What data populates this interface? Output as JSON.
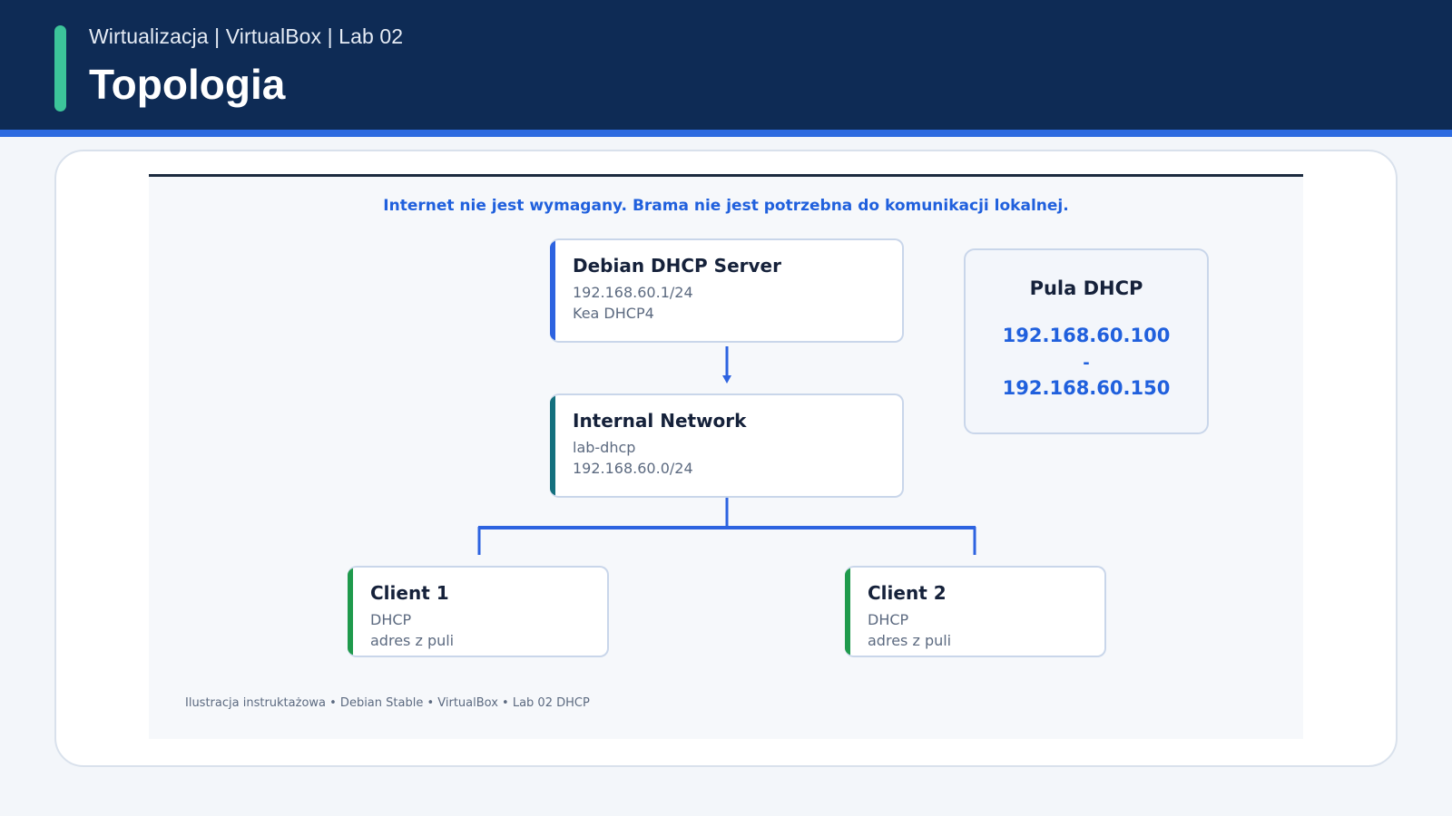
{
  "header": {
    "subtitle": "Wirtualizacja | VirtualBox | Lab 02",
    "title": "Topologia"
  },
  "diagram": {
    "note": "Internet nie jest wymagany. Brama nie jest potrzebna do komunikacji lokalnej.",
    "nodes": [
      {
        "title": "Debian DHCP Server",
        "lines": [
          "192.168.60.1/24",
          "Kea DHCP4"
        ],
        "accent": "#2d63e0"
      },
      {
        "title": "Internal Network",
        "lines": [
          "lab-dhcp",
          "192.168.60.0/24"
        ],
        "accent": "#14707e"
      },
      {
        "title": "Client 1",
        "lines": [
          "DHCP",
          "adres z puli"
        ],
        "accent": "#1f9a4c"
      },
      {
        "title": "Client 2",
        "lines": [
          "DHCP",
          "adres z puli"
        ],
        "accent": "#1f9a4c"
      }
    ],
    "pool": {
      "title": "Pula DHCP",
      "start": "192.168.60.100",
      "separator": "-",
      "end": "192.168.60.150"
    },
    "footer": "Ilustracja instruktażowa • Debian Stable • VirtualBox • Lab 02 DHCP",
    "connector_color": "#2d63e0"
  },
  "colors": {
    "header_bg": "#0e2b55",
    "header_accent": "#2d6be0",
    "marker": "#3cc49a",
    "highlight_text": "#2060dd"
  }
}
